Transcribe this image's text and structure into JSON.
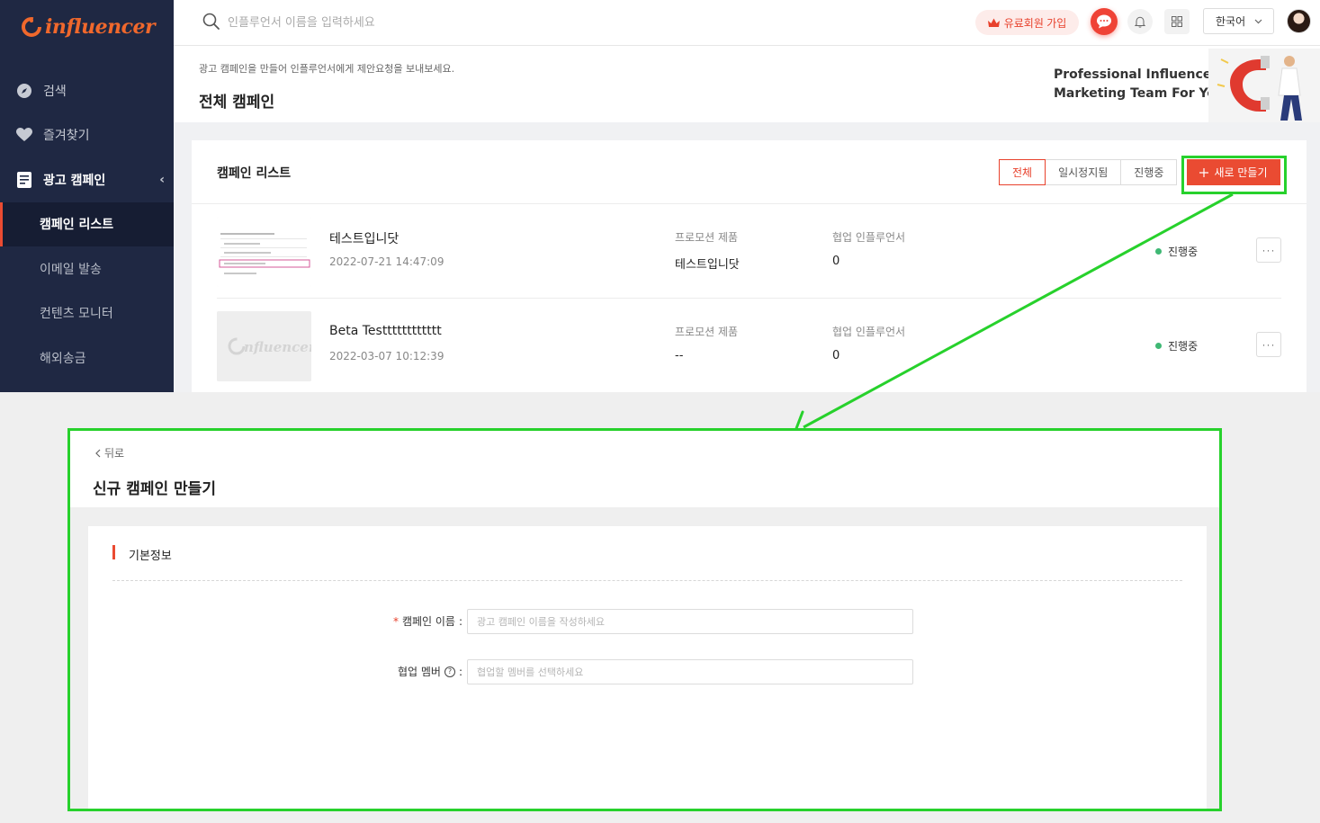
{
  "app": {
    "logo_text": "influencer",
    "brand_color": "#f0682c",
    "accent_color": "#ea4b32"
  },
  "sidebar": {
    "items": [
      {
        "label": "검색",
        "icon": "compass-icon"
      },
      {
        "label": "즐겨찾기",
        "icon": "heart-icon"
      },
      {
        "label": "광고 캠페인",
        "icon": "document-icon"
      }
    ],
    "sub_items": [
      {
        "label": "캠페인 리스트",
        "active": true
      },
      {
        "label": "이메일 발송"
      },
      {
        "label": "컨텐츠 모니터"
      },
      {
        "label": "해외송금"
      }
    ]
  },
  "topbar": {
    "search_placeholder": "인플루언서 이름을 입력하세요",
    "premium_label": "유료회원 가입",
    "language": "한국어"
  },
  "header": {
    "description": "광고 캠페인을 만들어 인플루언서에게 제안요청을 보내보세요.",
    "title": "전체 캠페인",
    "banner_line1": "Professional Influencer",
    "banner_line2": "Marketing Team For You"
  },
  "campaign_list": {
    "title": "캠페인 리스트",
    "filters": [
      "전체",
      "일시정지됨",
      "진행중"
    ],
    "new_button": "새로 만들기",
    "columns": {
      "product": "프로모션 제품",
      "influencers": "협업 인플루언서"
    },
    "rows": [
      {
        "name": "테스트입니닷",
        "date": "2022-07-21 14:47:09",
        "product": "테스트입니닷",
        "influencers": "0",
        "status": "진행중",
        "more": "···"
      },
      {
        "name": "Beta Testttttttttttt",
        "date": "2022-03-07 10:12:39",
        "product": "--",
        "influencers": "0",
        "status": "진행중",
        "more": "···"
      }
    ]
  },
  "detail": {
    "back_label": "뒤로",
    "title": "신규 캠페인 만들기",
    "section_title": "기본정보",
    "fields": {
      "campaign_name": {
        "label": "캠페인 이름",
        "placeholder": "광고 캠페인 이름을 작성하세요",
        "required": "*"
      },
      "members": {
        "label": "협업 멤버",
        "placeholder": "협업할 멤버를 선택하세요"
      }
    }
  },
  "annotation": {
    "color": "#27d12c"
  }
}
